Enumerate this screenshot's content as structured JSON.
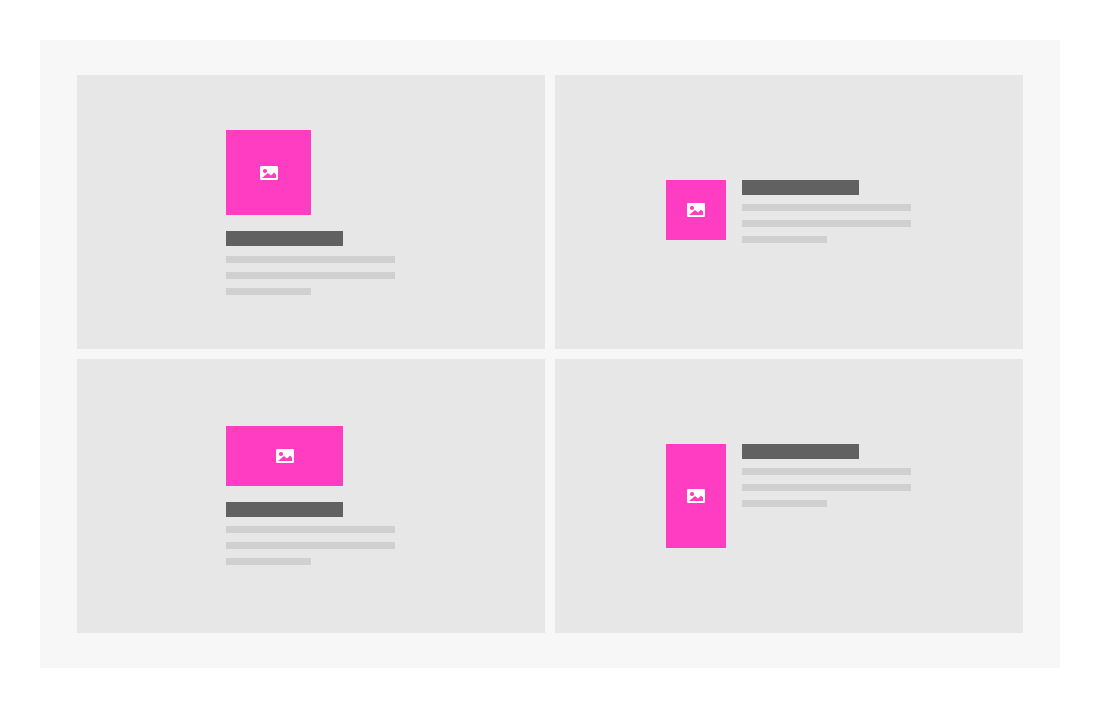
{
  "colors": {
    "page_background": "#ffffff",
    "frame_background": "#f7f7f7",
    "panel_background": "#e7e7e7",
    "media_accent": "#ff3dc2",
    "media_icon": "#ffffff",
    "title_placeholder": "#616161",
    "text_placeholder": "#d0d0d0"
  },
  "panels": [
    {
      "name": "panel-square-top",
      "layout": "media-top",
      "media_shape": "square",
      "icon": "image-icon",
      "title_lines": 1,
      "text_lines": 3
    },
    {
      "name": "panel-square-left",
      "layout": "media-left",
      "media_shape": "square",
      "icon": "image-icon",
      "title_lines": 1,
      "text_lines": 3
    },
    {
      "name": "panel-landscape-top",
      "layout": "media-top",
      "media_shape": "landscape",
      "icon": "image-icon",
      "title_lines": 1,
      "text_lines": 3
    },
    {
      "name": "panel-portrait-left",
      "layout": "media-left",
      "media_shape": "portrait",
      "icon": "image-icon",
      "title_lines": 1,
      "text_lines": 3
    }
  ]
}
